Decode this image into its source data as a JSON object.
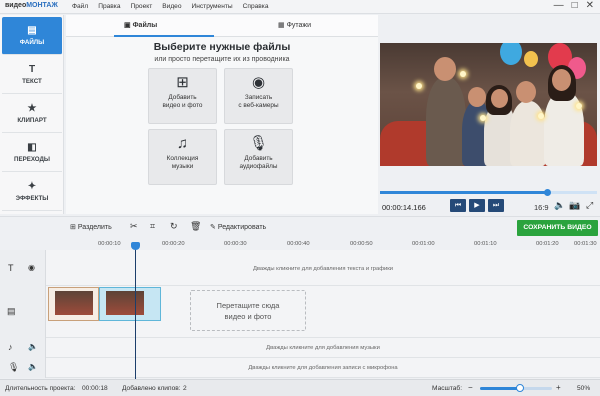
{
  "app": {
    "logo_a": "видео",
    "logo_b": "МОНТАЖ"
  },
  "menu": [
    "Файл",
    "Правка",
    "Проект",
    "Видео",
    "Инструменты",
    "Справка"
  ],
  "window_controls": [
    "—",
    "□",
    "✕"
  ],
  "sidebar": {
    "items": [
      {
        "label": "ФАЙЛЫ",
        "icon": "film-icon",
        "glyph": "▤",
        "active": true
      },
      {
        "label": "ТЕКСТ",
        "icon": "text-icon",
        "glyph": "T",
        "active": false
      },
      {
        "label": "КЛИПАРТ",
        "icon": "star-icon",
        "glyph": "★",
        "active": false
      },
      {
        "label": "ПЕРЕХОДЫ",
        "icon": "transitions-icon",
        "glyph": "◧",
        "active": false
      },
      {
        "label": "ЭФФЕКТЫ",
        "icon": "magic-wand-icon",
        "glyph": "✦",
        "active": false
      }
    ]
  },
  "content": {
    "tabs": [
      {
        "label": "Файлы",
        "icon": "image-icon",
        "glyph": "▣"
      },
      {
        "label": "Футажи",
        "icon": "film-strip-icon",
        "glyph": "▦"
      }
    ],
    "heading": "Выберите нужные файлы",
    "subheading": "или просто перетащите их из проводника",
    "tiles": [
      {
        "line1": "Добавить",
        "line2": "видео и фото",
        "icon": "film-reel-icon",
        "glyph": "⊞"
      },
      {
        "line1": "Записать",
        "line2": "с веб-камеры",
        "icon": "webcam-icon",
        "glyph": "◉"
      },
      {
        "line1": "Коллекция",
        "line2": "музыки",
        "icon": "music-notes-icon",
        "glyph": "♫"
      },
      {
        "line1": "Добавить",
        "line2": "аудиофайлы",
        "icon": "microphone-icon",
        "glyph": "🎙"
      }
    ]
  },
  "player": {
    "timecode": "00:00:14.166",
    "progress": 0.77,
    "aspect": "16:9",
    "buttons": [
      {
        "name": "prev-button",
        "glyph": "⏮"
      },
      {
        "name": "play-button",
        "glyph": "▶"
      },
      {
        "name": "next-button",
        "glyph": "⏭"
      }
    ],
    "icons": [
      {
        "name": "volume-icon",
        "glyph": "🔈"
      },
      {
        "name": "camera-icon",
        "glyph": "📷"
      },
      {
        "name": "fullscreen-icon",
        "glyph": "⤢"
      }
    ]
  },
  "toolbar": {
    "split": "Разделить",
    "edit": "Редактировать",
    "save": "СОХРАНИТЬ ВИДЕО",
    "save_color": "#2aa33d"
  },
  "ruler": [
    "00:00:10",
    "00:00:20",
    "00:00:30",
    "00:00:40",
    "00:00:50",
    "00:01:00",
    "00:01:10",
    "00:01:20",
    "00:01:30"
  ],
  "timeline": {
    "text_hint": "Дважды кликните для добавления текста и графики",
    "drop_line1": "Перетащите сюда",
    "drop_line2": "видео и фото",
    "music_hint": "Дважды кликните для добавления музыки",
    "mic_hint": "Дважды кликните для добавления записи с микрофона"
  },
  "status": {
    "duration_label": "Длительность проекта:",
    "duration": "00:00:18",
    "clips_label": "Добавлено клипов:",
    "clips": "2",
    "zoom_label": "Масштаб:",
    "zoom": "50%",
    "zoom_value": 0.55
  },
  "accent_color": "#2f86d8"
}
